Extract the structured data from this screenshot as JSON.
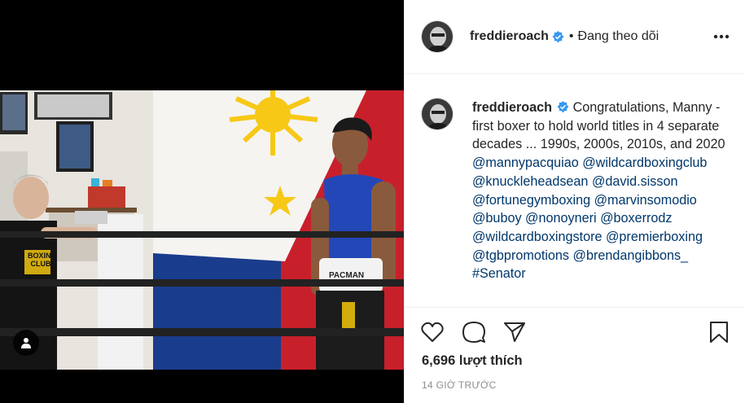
{
  "post": {
    "username": "freddieroach",
    "follow_status": "Đang theo dõi",
    "separator": "•",
    "caption_text": "Congratulations, Manny - first boxer to hold world titles in 4 separate decades ... 1990s, 2000s, 2010s, and 2020",
    "mentions": [
      "@mannypacquiao",
      "@wildcardboxingclub",
      "@knuckleheadsean",
      "@david.sisson",
      "@fortunegymboxing",
      "@marvinsomodio",
      "@buboy",
      "@nonoyneri",
      "@boxerrodz",
      "@wildcardboxingstore",
      "@premierboxing",
      "@tgbpromotions",
      "@brendangibbons_",
      "#Senator"
    ],
    "likes": "6,696 lượt thích",
    "timestamp": "14 GIỜ TRƯỚC"
  },
  "photo": {
    "shirt_text": "BOXING CLUB",
    "waistband_text": "PACMAN"
  },
  "icons": {
    "more": "more-options-icon",
    "verified": "verified-badge-icon",
    "like": "heart-icon",
    "comment": "comment-icon",
    "share": "paper-plane-icon",
    "save": "bookmark-icon",
    "user_tag": "user-icon"
  },
  "colors": {
    "verified": "#3897f0",
    "link": "#00376b",
    "flag_blue": "#1a3c8c",
    "flag_red": "#c8202b",
    "flag_yellow": "#f7c816",
    "muted": "#8e8e8e"
  }
}
